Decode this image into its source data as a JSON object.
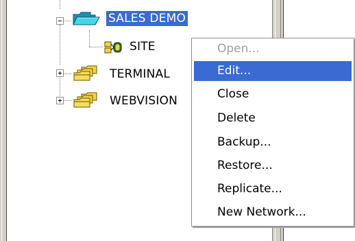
{
  "tree": {
    "items": [
      {
        "label": "SALES DEMO",
        "state": "expanded",
        "selected": true,
        "icon": "open-folder-icon"
      },
      {
        "label": "SITE",
        "icon": "site-network-icon"
      },
      {
        "label": "TERMINAL",
        "state": "collapsed",
        "icon": "folder-group-icon"
      },
      {
        "label": "WEBVISION",
        "state": "collapsed",
        "icon": "folder-group-icon"
      }
    ]
  },
  "context_menu": {
    "items": [
      {
        "label": "Open...",
        "enabled": false
      },
      {
        "label": "Edit...",
        "highlighted": true
      },
      {
        "label": "Close"
      },
      {
        "label": "Delete"
      },
      {
        "label": "Backup..."
      },
      {
        "label": "Restore..."
      },
      {
        "label": "Replicate..."
      },
      {
        "label": "New Network..."
      }
    ]
  },
  "colors": {
    "selection": "#3a6ad2",
    "folder_yellow": "#f2d34b",
    "open_folder_cyan": "#48d4ec",
    "chrome_gray": "#d4d0c8"
  }
}
